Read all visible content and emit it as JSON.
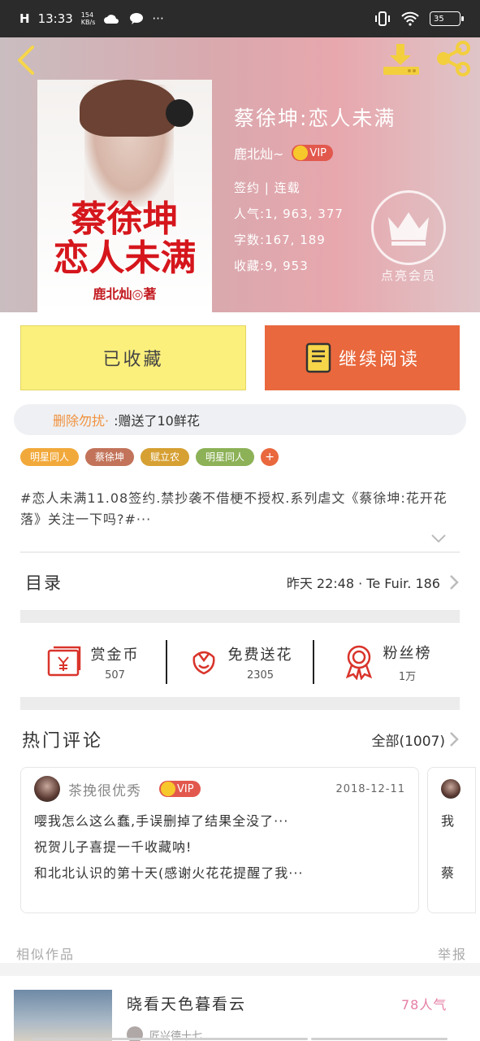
{
  "status_bar": {
    "signal": "H",
    "time": "13:33",
    "net_speed_top": "154",
    "net_speed_bottom": "KB/s",
    "more": "···",
    "battery": "35"
  },
  "book": {
    "title": "蔡徐坤:恋人未满",
    "author": "鹿北灿~",
    "vip_label": "VIP",
    "status": "签约 | 连载",
    "popularity": "人气:1, 963, 377",
    "word_count": "字数:167, 189",
    "collections": "收藏:9, 953",
    "cover_title": "蔡徐坤\n恋人未满",
    "cover_author": "鹿北灿◎著"
  },
  "member": {
    "label": "点亮会员"
  },
  "buttons": {
    "collect_label": "已收藏",
    "read_label": "继续阅读"
  },
  "gift": {
    "user": "删除勿扰·",
    "text": ":赠送了10鲜花"
  },
  "tags": [
    {
      "label": "明星同人",
      "color": "#f2a93b"
    },
    {
      "label": "蔡徐坤",
      "color": "#c2735a"
    },
    {
      "label": "赋立农",
      "color": "#d6a033"
    },
    {
      "label": "明星同人",
      "color": "#8cb157"
    }
  ],
  "tag_more": "+",
  "description": "#恋人未满11.08签约.禁抄袭不借梗不授权.系列虐文《蔡徐坤:花开花落》关注一下吗?#···",
  "catalog": {
    "title": "目录",
    "update": "昨天 22:48 · Te Fuir. 186"
  },
  "actions": [
    {
      "label": "赏金币",
      "value": "507",
      "icon": "red-envelope-icon"
    },
    {
      "label": "免费送花",
      "value": "2305",
      "icon": "flower-icon"
    },
    {
      "label": "粉丝榜",
      "value": "1万",
      "icon": "medal-icon"
    }
  ],
  "hot_comments": {
    "title": "热门评论",
    "all_label": "全部(1007)"
  },
  "comment": {
    "name": "茶挽很优秀",
    "vip_label": "VIP",
    "date": "2018-12-11",
    "lines": [
      "嘤我怎么这么蠢,手误删掉了结果全没了···",
      "祝贺儿子喜提一千收藏呐!",
      "和北北认识的第十天(感谢火花花提醒了我···"
    ]
  },
  "comment2": {
    "line1": "我",
    "line2": "蔡"
  },
  "similar": {
    "title": "相似作品",
    "report": "举报"
  },
  "recommend": {
    "title": "晓看天色暮看云",
    "popularity": "78人气",
    "author": "匠兴德十七"
  },
  "colors": {
    "accent_orange": "#e9683d",
    "collect_yellow": "#fbf07c",
    "vip_red": "#e2584d",
    "icon_red": "#d9342b"
  }
}
